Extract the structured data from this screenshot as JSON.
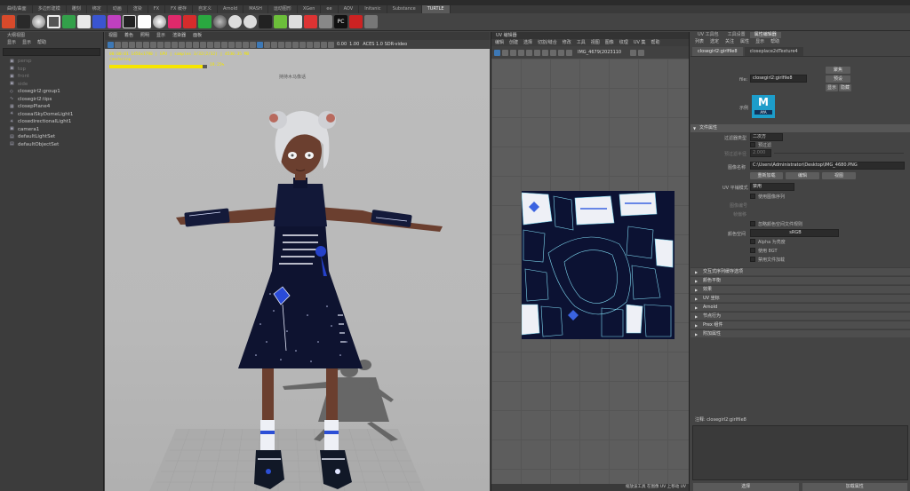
{
  "shelf_tabs": [
    "曲线/曲面",
    "多边形建模",
    "雕刻",
    "绑定",
    "动画",
    "渲染",
    "FX",
    "FX 缓存",
    "自定义",
    "Arnold",
    "MASH",
    "运动图形",
    "XGen",
    "ee",
    "AOV",
    "Initanic",
    "Substance",
    "TURTLE"
  ],
  "active_shelf_tab_index": 17,
  "outliner": {
    "title": "大纲视图",
    "menu": [
      "显示",
      "显示",
      "帮助"
    ],
    "items": [
      {
        "label": "persp",
        "icon": "camera-icon",
        "dim": true
      },
      {
        "label": "top",
        "icon": "camera-icon",
        "dim": true
      },
      {
        "label": "front",
        "icon": "camera-icon",
        "dim": true
      },
      {
        "label": "side",
        "icon": "camera-icon",
        "dim": true
      },
      {
        "label": "closegirl2:group1",
        "icon": "group-icon",
        "dim": false
      },
      {
        "label": "closegirl2:tips",
        "icon": "curve-icon",
        "dim": false
      },
      {
        "label": "closepPlane4",
        "icon": "mesh-icon",
        "dim": false
      },
      {
        "label": "closeaiSkyDomeLight1",
        "icon": "light-icon",
        "dim": false
      },
      {
        "label": "closedirectionalLight1",
        "icon": "light-icon",
        "dim": false
      },
      {
        "label": "camera1",
        "icon": "camera-icon",
        "dim": false
      },
      {
        "label": "defaultLightSet",
        "icon": "set-icon",
        "dim": false
      },
      {
        "label": "defaultObjectSet",
        "icon": "set-icon",
        "dim": false
      }
    ]
  },
  "viewport": {
    "menu": [
      "视图",
      "着色",
      "照明",
      "显示",
      "渲染器",
      "面板"
    ],
    "exposure": "0.00",
    "gamma": "1.00",
    "color_space": "ACES 1.0 SDR-video",
    "render_info": [
      "00:00:01 1456x1790 | GPU | samples 3/32(2/32) | 4530.35 MB",
      "rendering"
    ],
    "render_progress": 0.95,
    "render_progress_label": "19.25%",
    "caption": "持持木马像话"
  },
  "uv_editor": {
    "title": "UV 编辑器",
    "menu": [
      "编辑",
      "创建",
      "选择",
      "切割/缝合",
      "修改",
      "工具",
      "视图",
      "图像",
      "纹理",
      "UV 集",
      "帮助"
    ],
    "image_name": "IMG_4679(2023110",
    "status": "缩放该工具 在图像 UV 上移动 UV"
  },
  "attribute_editor": {
    "tabs": [
      "UV 工具包",
      "工具设置",
      "属性编辑器"
    ],
    "active_tab_index": 2,
    "menu": [
      "列表",
      "选定",
      "关注",
      "属性",
      "显示",
      "帮助"
    ],
    "node_tabs": [
      "closegirl2:girlfile8",
      "closeplace2dTexture4"
    ],
    "active_node_tab_index": 0,
    "file_label": "file:",
    "file_value": "closegirl2:girlfile8",
    "btn_focus": "聚焦",
    "btn_preset": "预设",
    "btn_show": "显示",
    "btn_hide": "隐藏",
    "sample_label": "示例",
    "section_file_attrs": "文件属性",
    "filter_type_label": "过滤器类型",
    "filter_type_value": "二次方",
    "prefilter_label": "预过滤",
    "prefilter_radius_label": "预过滤半径",
    "prefilter_radius_value": "2.000",
    "image_name_label": "图像名称",
    "image_path": "C:\\Users\\Administrator\\Desktop\\IMG_4680.PNG",
    "btn_reload": "重新加载",
    "btn_edit": "编辑",
    "btn_view": "视图",
    "uv_tiling_label": "UV 平铺模式",
    "uv_tiling_value": "禁用",
    "use_seq_label": "使用图像序列",
    "frame_ext_label": "图像编号",
    "frame_offset_label": "帧偏移",
    "ignore_cs_label": "忽略颜色空间文件规则",
    "color_space_label": "颜色空间",
    "color_space_value": "sRGB",
    "alpha_lum_label": "Alpha 为亮度",
    "use_ocio_label": "使用 8GT",
    "disable_file_load_label": "禁用文件加载",
    "collapsed_sections": [
      "交互式序列缓存选项",
      "颜色平衡",
      "效果",
      "UV 坐标",
      "Arnold",
      "节点行为",
      "Prex 组件",
      "附加属性"
    ],
    "notes_label": "注释: closegirl2:girlfile8",
    "btn_select": "选择",
    "btn_load_attrs": "加载属性"
  }
}
